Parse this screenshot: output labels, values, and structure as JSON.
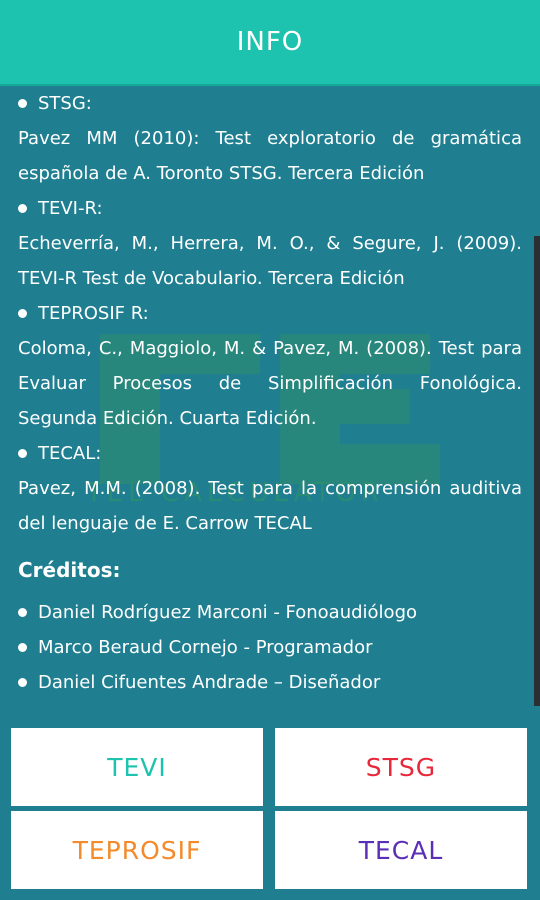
{
  "appbar": {
    "title": "INFO"
  },
  "watermark": {
    "text": "TEL CALCULATOR"
  },
  "references": [
    {
      "label": "STSG:",
      "text": "Pavez MM (2010): Test exploratorio de gramática española de A. Toronto STSG. Tercera Edición"
    },
    {
      "label": "TEVI-R:",
      "text": "Echeverría, M., Herrera, M. O., & Segure, J. (2009). TEVI-R Test de Vocabulario. Tercera Edición"
    },
    {
      "label": "TEPROSIF R:",
      "text": "Coloma, C., Maggiolo, M. & Pavez, M. (2008). Test para Evaluar Procesos de Simplificación Fonológica. Segunda Edición. Cuarta Edición."
    },
    {
      "label": "TECAL:",
      "text": "Pavez, M.M. (2008). Test para la comprensión auditiva del lenguaje de E. Carrow TECAL"
    }
  ],
  "credits": {
    "title": "Créditos:",
    "items": [
      "Daniel Rodríguez Marconi - Fonoaudiólogo",
      "Marco Beraud Cornejo - Programador",
      "Daniel Cifuentes Andrade – Diseñador"
    ]
  },
  "buttons": {
    "tevi": "TEVI",
    "stsg": "STSG",
    "teprosif": "TEPROSIF",
    "tecal": "TECAL"
  },
  "colors": {
    "appbar": "#1dc3ae",
    "background": "#1f7f91",
    "tevi": "#1dc3ae",
    "stsg": "#e8283a",
    "teprosif": "#f38b2b",
    "tecal": "#5a2fb5"
  }
}
